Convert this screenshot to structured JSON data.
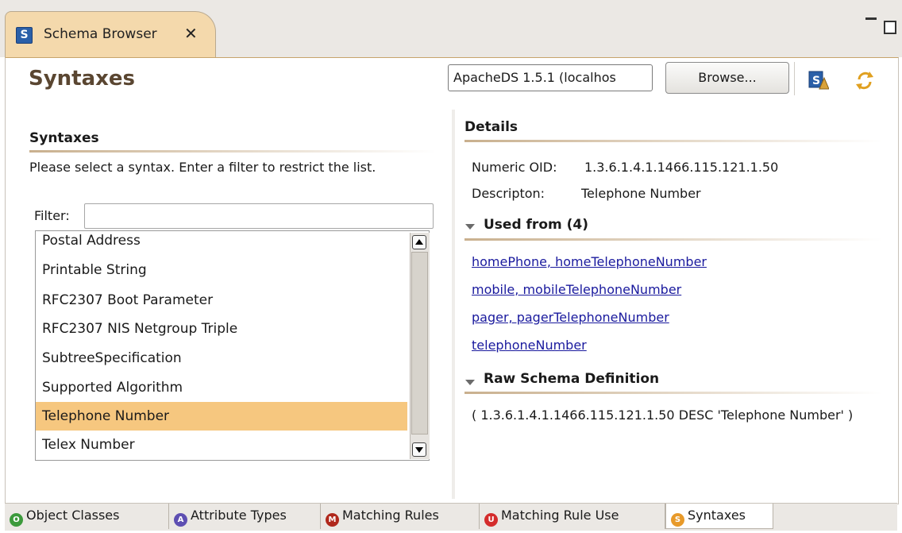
{
  "editor_tab": {
    "title": "Schema Browser",
    "icon": "schema-browser-icon"
  },
  "page": {
    "title": "Syntaxes"
  },
  "toolbar": {
    "connection_value": "ApacheDS 1.5.1 (localhos",
    "browse_label": "Browse..."
  },
  "syntaxes_section": {
    "heading": "Syntaxes",
    "description": "Please select a syntax. Enter a filter to restrict the list.",
    "filter_label": "Filter:",
    "filter_value": "",
    "items": [
      "Postal Address",
      "Printable String",
      "RFC2307 Boot Parameter",
      "RFC2307 NIS Netgroup Triple",
      "SubtreeSpecification",
      "Supported Algorithm",
      "Telephone Number",
      "Telex Number"
    ],
    "selected": "Telephone Number"
  },
  "details": {
    "heading": "Details",
    "oid_label": "Numeric OID:",
    "oid_value": "1.3.6.1.4.1.1466.115.121.1.50",
    "desc_label": "Descripton:",
    "desc_value": "Telephone Number",
    "used_from_heading": "Used from (4)",
    "used_from": [
      "homePhone, homeTelephoneNumber",
      "mobile, mobileTelephoneNumber",
      "pager, pagerTelephoneNumber",
      "telephoneNumber"
    ],
    "raw_heading": "Raw Schema Definition",
    "raw_value": "( 1.3.6.1.4.1.1466.115.121.1.50 DESC 'Telephone Number' )"
  },
  "bottom_tabs": [
    {
      "label": "Object Classes",
      "icon_letter": "O",
      "icon_color": "#3c9a3c"
    },
    {
      "label": "Attribute Types",
      "icon_letter": "A",
      "icon_color": "#5e4fb2"
    },
    {
      "label": "Matching Rules",
      "icon_letter": "M",
      "icon_color": "#b0281c"
    },
    {
      "label": "Matching Rule Use",
      "icon_letter": "U",
      "icon_color": "#d42c2c"
    },
    {
      "label": "Syntaxes",
      "icon_letter": "S",
      "icon_color": "#e89a2a"
    }
  ],
  "active_bottom_tab": "Syntaxes"
}
